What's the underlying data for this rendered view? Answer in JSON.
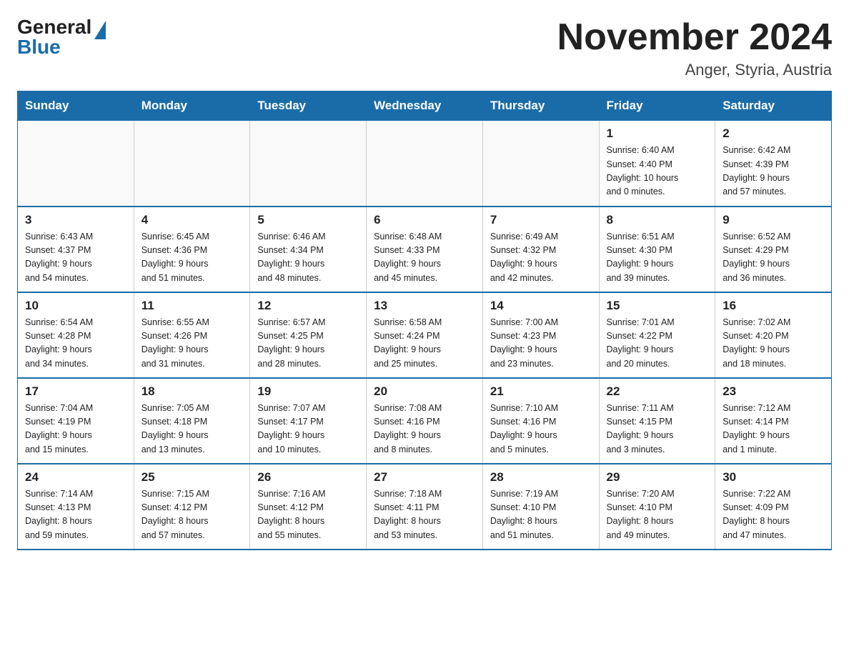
{
  "logo": {
    "general": "General",
    "blue": "Blue"
  },
  "title": "November 2024",
  "location": "Anger, Styria, Austria",
  "weekdays": [
    "Sunday",
    "Monday",
    "Tuesday",
    "Wednesday",
    "Thursday",
    "Friday",
    "Saturday"
  ],
  "weeks": [
    [
      {
        "day": "",
        "info": ""
      },
      {
        "day": "",
        "info": ""
      },
      {
        "day": "",
        "info": ""
      },
      {
        "day": "",
        "info": ""
      },
      {
        "day": "",
        "info": ""
      },
      {
        "day": "1",
        "info": "Sunrise: 6:40 AM\nSunset: 4:40 PM\nDaylight: 10 hours\nand 0 minutes."
      },
      {
        "day": "2",
        "info": "Sunrise: 6:42 AM\nSunset: 4:39 PM\nDaylight: 9 hours\nand 57 minutes."
      }
    ],
    [
      {
        "day": "3",
        "info": "Sunrise: 6:43 AM\nSunset: 4:37 PM\nDaylight: 9 hours\nand 54 minutes."
      },
      {
        "day": "4",
        "info": "Sunrise: 6:45 AM\nSunset: 4:36 PM\nDaylight: 9 hours\nand 51 minutes."
      },
      {
        "day": "5",
        "info": "Sunrise: 6:46 AM\nSunset: 4:34 PM\nDaylight: 9 hours\nand 48 minutes."
      },
      {
        "day": "6",
        "info": "Sunrise: 6:48 AM\nSunset: 4:33 PM\nDaylight: 9 hours\nand 45 minutes."
      },
      {
        "day": "7",
        "info": "Sunrise: 6:49 AM\nSunset: 4:32 PM\nDaylight: 9 hours\nand 42 minutes."
      },
      {
        "day": "8",
        "info": "Sunrise: 6:51 AM\nSunset: 4:30 PM\nDaylight: 9 hours\nand 39 minutes."
      },
      {
        "day": "9",
        "info": "Sunrise: 6:52 AM\nSunset: 4:29 PM\nDaylight: 9 hours\nand 36 minutes."
      }
    ],
    [
      {
        "day": "10",
        "info": "Sunrise: 6:54 AM\nSunset: 4:28 PM\nDaylight: 9 hours\nand 34 minutes."
      },
      {
        "day": "11",
        "info": "Sunrise: 6:55 AM\nSunset: 4:26 PM\nDaylight: 9 hours\nand 31 minutes."
      },
      {
        "day": "12",
        "info": "Sunrise: 6:57 AM\nSunset: 4:25 PM\nDaylight: 9 hours\nand 28 minutes."
      },
      {
        "day": "13",
        "info": "Sunrise: 6:58 AM\nSunset: 4:24 PM\nDaylight: 9 hours\nand 25 minutes."
      },
      {
        "day": "14",
        "info": "Sunrise: 7:00 AM\nSunset: 4:23 PM\nDaylight: 9 hours\nand 23 minutes."
      },
      {
        "day": "15",
        "info": "Sunrise: 7:01 AM\nSunset: 4:22 PM\nDaylight: 9 hours\nand 20 minutes."
      },
      {
        "day": "16",
        "info": "Sunrise: 7:02 AM\nSunset: 4:20 PM\nDaylight: 9 hours\nand 18 minutes."
      }
    ],
    [
      {
        "day": "17",
        "info": "Sunrise: 7:04 AM\nSunset: 4:19 PM\nDaylight: 9 hours\nand 15 minutes."
      },
      {
        "day": "18",
        "info": "Sunrise: 7:05 AM\nSunset: 4:18 PM\nDaylight: 9 hours\nand 13 minutes."
      },
      {
        "day": "19",
        "info": "Sunrise: 7:07 AM\nSunset: 4:17 PM\nDaylight: 9 hours\nand 10 minutes."
      },
      {
        "day": "20",
        "info": "Sunrise: 7:08 AM\nSunset: 4:16 PM\nDaylight: 9 hours\nand 8 minutes."
      },
      {
        "day": "21",
        "info": "Sunrise: 7:10 AM\nSunset: 4:16 PM\nDaylight: 9 hours\nand 5 minutes."
      },
      {
        "day": "22",
        "info": "Sunrise: 7:11 AM\nSunset: 4:15 PM\nDaylight: 9 hours\nand 3 minutes."
      },
      {
        "day": "23",
        "info": "Sunrise: 7:12 AM\nSunset: 4:14 PM\nDaylight: 9 hours\nand 1 minute."
      }
    ],
    [
      {
        "day": "24",
        "info": "Sunrise: 7:14 AM\nSunset: 4:13 PM\nDaylight: 8 hours\nand 59 minutes."
      },
      {
        "day": "25",
        "info": "Sunrise: 7:15 AM\nSunset: 4:12 PM\nDaylight: 8 hours\nand 57 minutes."
      },
      {
        "day": "26",
        "info": "Sunrise: 7:16 AM\nSunset: 4:12 PM\nDaylight: 8 hours\nand 55 minutes."
      },
      {
        "day": "27",
        "info": "Sunrise: 7:18 AM\nSunset: 4:11 PM\nDaylight: 8 hours\nand 53 minutes."
      },
      {
        "day": "28",
        "info": "Sunrise: 7:19 AM\nSunset: 4:10 PM\nDaylight: 8 hours\nand 51 minutes."
      },
      {
        "day": "29",
        "info": "Sunrise: 7:20 AM\nSunset: 4:10 PM\nDaylight: 8 hours\nand 49 minutes."
      },
      {
        "day": "30",
        "info": "Sunrise: 7:22 AM\nSunset: 4:09 PM\nDaylight: 8 hours\nand 47 minutes."
      }
    ]
  ]
}
